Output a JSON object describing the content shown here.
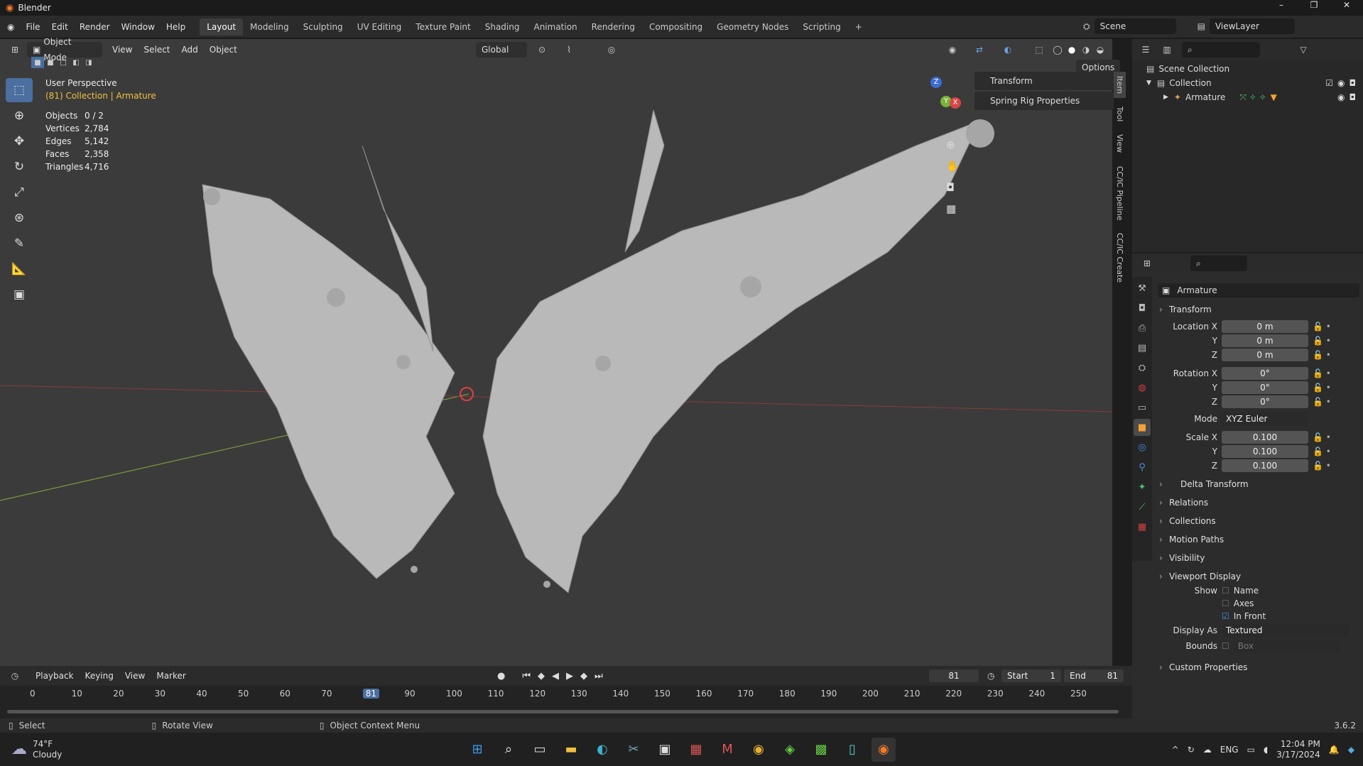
{
  "window": {
    "title": "Blender",
    "controls": [
      "–",
      "❐",
      "✕"
    ]
  },
  "menu": [
    "File",
    "Edit",
    "Render",
    "Window",
    "Help"
  ],
  "workspaces": [
    "Layout",
    "Modeling",
    "Sculpting",
    "UV Editing",
    "Texture Paint",
    "Shading",
    "Animation",
    "Rendering",
    "Compositing",
    "Geometry Nodes",
    "Scripting",
    "+"
  ],
  "scene_name": "Scene",
  "view_layer": "ViewLayer",
  "vp_header": {
    "mode": "Object Mode",
    "menus": [
      "View",
      "Select",
      "Add",
      "Object"
    ],
    "orientation": "Global",
    "options": "Options"
  },
  "overlay": {
    "view": "User Perspective",
    "collection": "(81) Collection | Armature",
    "stats": [
      {
        "k": "Objects",
        "v": "0 / 2"
      },
      {
        "k": "Vertices",
        "v": "2,784"
      },
      {
        "k": "Edges",
        "v": "5,142"
      },
      {
        "k": "Faces",
        "v": "2,358"
      },
      {
        "k": "Triangles",
        "v": "4,716"
      }
    ]
  },
  "npanel": {
    "items": [
      "Transform",
      "Spring Rig Properties"
    ],
    "tabs": [
      "Item",
      "Tool",
      "View",
      "CC/IC Pipeline",
      "CC/IC Create"
    ]
  },
  "gizmo": {
    "z": "Z",
    "y": "Y",
    "x": "X"
  },
  "outliner": {
    "root": "Scene Collection",
    "collection": "Collection",
    "object": "Armature"
  },
  "props": {
    "object_name": "Armature",
    "transform": "Transform",
    "location": {
      "label": "Location X",
      "x": "0 m",
      "y": "0 m",
      "z": "0 m"
    },
    "rotation": {
      "label": "Rotation X",
      "x": "0°",
      "y": "0°",
      "z": "0°"
    },
    "mode_label": "Mode",
    "mode": "XYZ Euler",
    "scale": {
      "label": "Scale X",
      "x": "0.100",
      "y": "0.100",
      "z": "0.100"
    },
    "axis_y": "Y",
    "axis_z": "Z",
    "delta": "Delta Transform",
    "sections": [
      "Relations",
      "Collections",
      "Motion Paths",
      "Visibility"
    ],
    "viewport_display": "Viewport Display",
    "show_label": "Show",
    "show_name": "Name",
    "show_axes": "Axes",
    "show_infront": "In Front",
    "display_as_label": "Display As",
    "display_as": "Textured",
    "bounds_label": "Bounds",
    "bounds": "Box",
    "custom": "Custom Properties"
  },
  "timeline": {
    "menus": [
      "Playback",
      "Keying",
      "View",
      "Marker"
    ],
    "current": "81",
    "start_label": "Start",
    "start": "1",
    "end_label": "End",
    "end": "81",
    "ticks": [
      "0",
      "10",
      "20",
      "30",
      "40",
      "50",
      "60",
      "70",
      "81",
      "90",
      "100",
      "110",
      "120",
      "130",
      "140",
      "150",
      "160",
      "170",
      "180",
      "190",
      "200",
      "210",
      "220",
      "230",
      "240",
      "250"
    ]
  },
  "status": {
    "select": "Select",
    "rotate": "Rotate View",
    "context": "Object Context Menu",
    "version": "3.6.2"
  },
  "taskbar": {
    "temp": "74°F",
    "weather": "Cloudy",
    "lang": "ENG",
    "time": "12:04 PM",
    "date": "3/17/2024"
  }
}
